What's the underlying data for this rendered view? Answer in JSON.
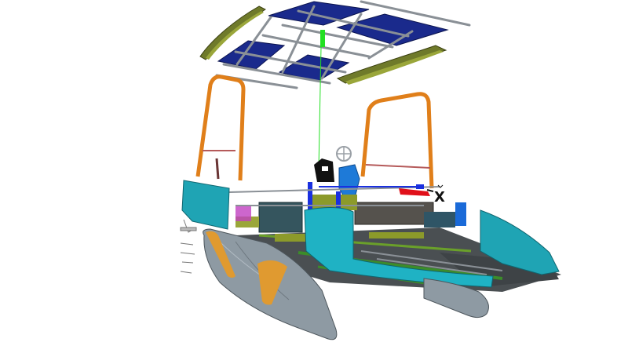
{
  "viewport": {
    "axis_label": "X"
  },
  "colors": {
    "solar_panel": "#1a2a8c",
    "frame_gray": "#8a9096",
    "roll_bar_orange": "#e07f1a",
    "hull_teal": "#1fb2c4",
    "pontoon_gray": "#8e9aa3",
    "deck_dark": "#4a4f52",
    "accent_green": "#3c8c2a",
    "olive": "#8c9a2a",
    "axis_red": "#e0101a",
    "axis_blue": "#1a30e0",
    "axis_green": "#22e022",
    "seat_black": "#111111",
    "seat_blue": "#1e7ad8"
  }
}
